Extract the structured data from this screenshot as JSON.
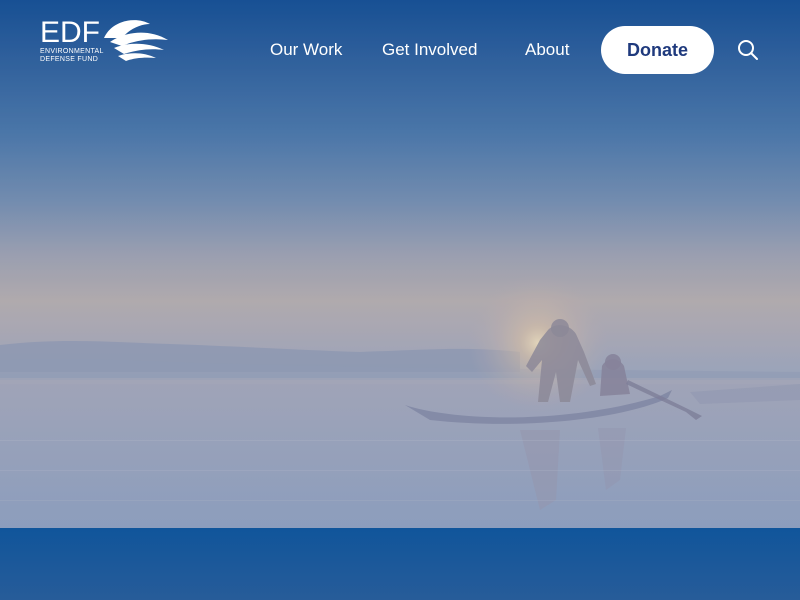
{
  "logo": {
    "letters": "EDF",
    "line1": "ENVIRONMENTAL",
    "line2": "DEFENSE FUND"
  },
  "nav": {
    "items": [
      {
        "label": "Our Work"
      },
      {
        "label": "Get Involved"
      },
      {
        "label": "About"
      }
    ],
    "donate_label": "Donate",
    "search_icon": "search-icon"
  },
  "colors": {
    "brand_blue": "#10559b",
    "donate_text": "#1f3a7d",
    "white": "#ffffff"
  }
}
